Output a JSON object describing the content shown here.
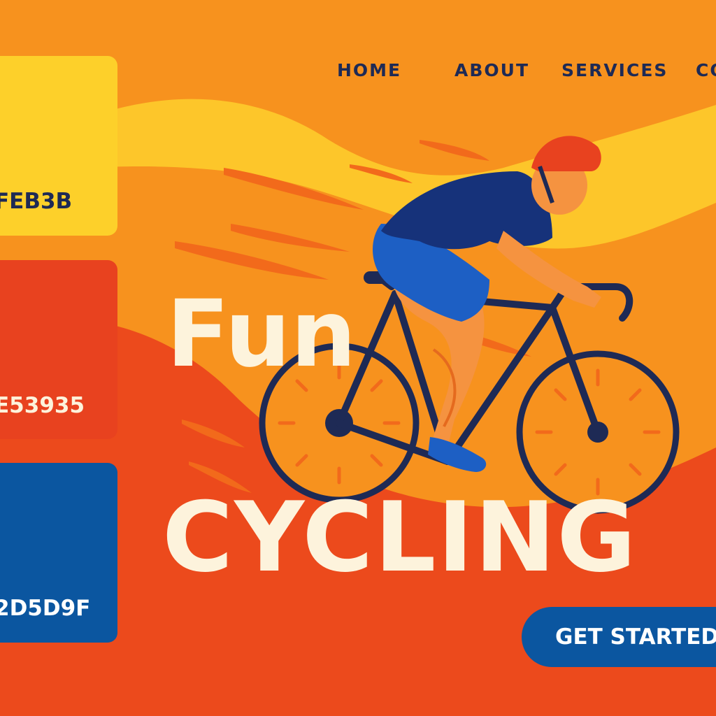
{
  "nav": {
    "items": [
      {
        "label": "HOME"
      },
      {
        "label": "ABOUT"
      },
      {
        "label": "SERVICES"
      },
      {
        "label": "CO"
      }
    ]
  },
  "palette": [
    {
      "hex_label": "FEB3B",
      "color": "#fdd02a",
      "text_color": "#1e2a55"
    },
    {
      "hex_label": "E53935",
      "color": "#e8421f",
      "text_color": "#fdf3dc"
    },
    {
      "hex_label": "2D5D9F",
      "color": "#0b56a0",
      "text_color": "#ffffff"
    }
  ],
  "hero": {
    "title_line1": "Fun",
    "title_line2": "CYCLING"
  },
  "cta": {
    "label": "GET STARTED",
    "color": "#0b56a0"
  },
  "colors": {
    "background_orange": "#f7921e",
    "accent_yellow": "#fdd02a",
    "accent_red": "#e8421f",
    "navy": "#1e2a55",
    "title_cream": "#fdf3dc"
  }
}
